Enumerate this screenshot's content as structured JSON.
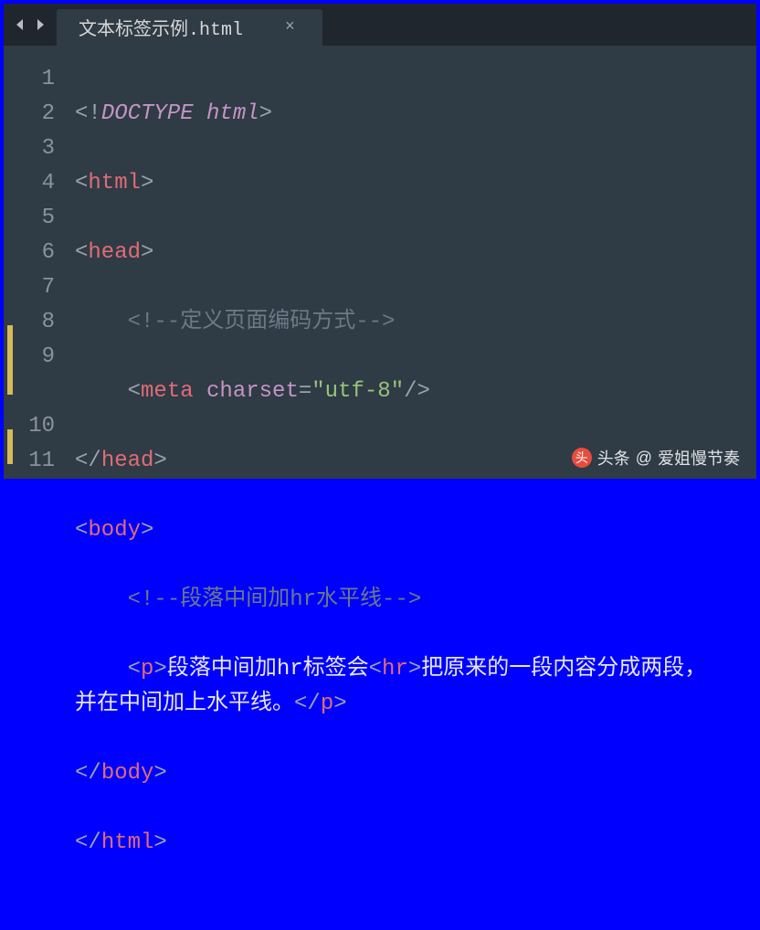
{
  "tab": {
    "title": "文本标签示例.html",
    "close_glyph": "×"
  },
  "gutter": [
    "1",
    "2",
    "3",
    "4",
    "5",
    "6",
    "7",
    "8",
    "9",
    "",
    "10",
    "11"
  ],
  "code": {
    "l1": {
      "open": "<!",
      "doc": "DOCTYPE html",
      "close": ">"
    },
    "l2": {
      "open": "<",
      "tag": "html",
      "close": ">"
    },
    "l3": {
      "open": "<",
      "tag": "head",
      "close": ">"
    },
    "l4": {
      "cmt": "<!--定义页面编码方式-->"
    },
    "l5": {
      "open": "<",
      "tag": "meta",
      "sp": " ",
      "attr": "charset",
      "eq": "=",
      "q": "\"",
      "val": "utf-8",
      "selfclose": "/>"
    },
    "l6": {
      "open": "</",
      "tag": "head",
      "close": ">"
    },
    "l7": {
      "open": "<",
      "tag": "body",
      "close": ">"
    },
    "l8": {
      "cmt": "<!--段落中间加hr水平线-->"
    },
    "l9": {
      "open": "<",
      "tag": "p",
      "close": ">",
      "txt1": "段落中间加hr标签会",
      "hr": "hr",
      "txt2": "把原来的一段内容分成两段，并在中间加上水平线。",
      "endopen": "</",
      "endtag": "p",
      "endclose": ">"
    },
    "l10": {
      "open": "</",
      "tag": "body",
      "close": ">"
    },
    "l11": {
      "open": "</",
      "tag": "html",
      "close": ">"
    }
  },
  "watermark": {
    "brand": "头条",
    "at": "@",
    "author": "爱姐慢节奏"
  }
}
